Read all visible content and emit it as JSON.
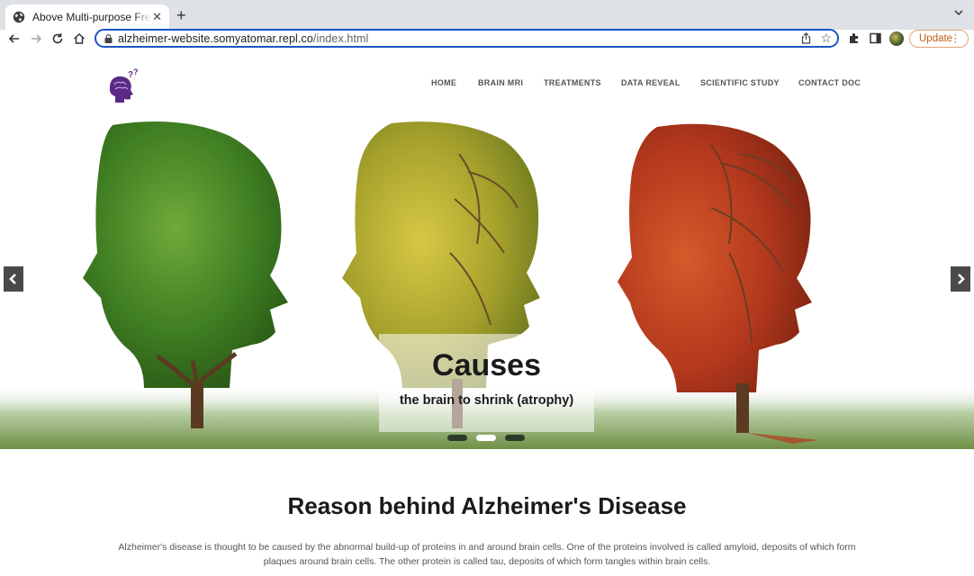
{
  "browser": {
    "tab_title": "Above Multi-purpose Free Boo",
    "url_host": "alzheimer-website.somyatomar.repl.co",
    "url_path": "/index.html",
    "update_label": "Update"
  },
  "site": {
    "nav": [
      {
        "label": "HOME",
        "active": true
      },
      {
        "label": "BRAIN MRI",
        "active": false
      },
      {
        "label": "TREATMENTS",
        "active": false
      },
      {
        "label": "DATA REVEAL",
        "active": false
      },
      {
        "label": "SCIENTIFIC STUDY",
        "active": false
      },
      {
        "label": "CONTACT DOC",
        "active": false
      }
    ],
    "accent_color": "#2e9f7a",
    "logo_color": "#5b2a86"
  },
  "hero": {
    "caption_title": "Causes",
    "caption_subtitle": "the brain to shrink (atrophy)",
    "slide_count": 3,
    "active_slide": 2,
    "prev_icon": "chevron-left-icon",
    "next_icon": "chevron-right-icon"
  },
  "section": {
    "title": "Reason behind Alzheimer's Disease",
    "body": "Alzheimer's disease is thought to be caused by the abnormal build-up of proteins in and around brain cells. One of the proteins involved is called amyloid, deposits of which form plaques around brain cells. The other protein is called tau, deposits of which form tangles within brain cells."
  }
}
